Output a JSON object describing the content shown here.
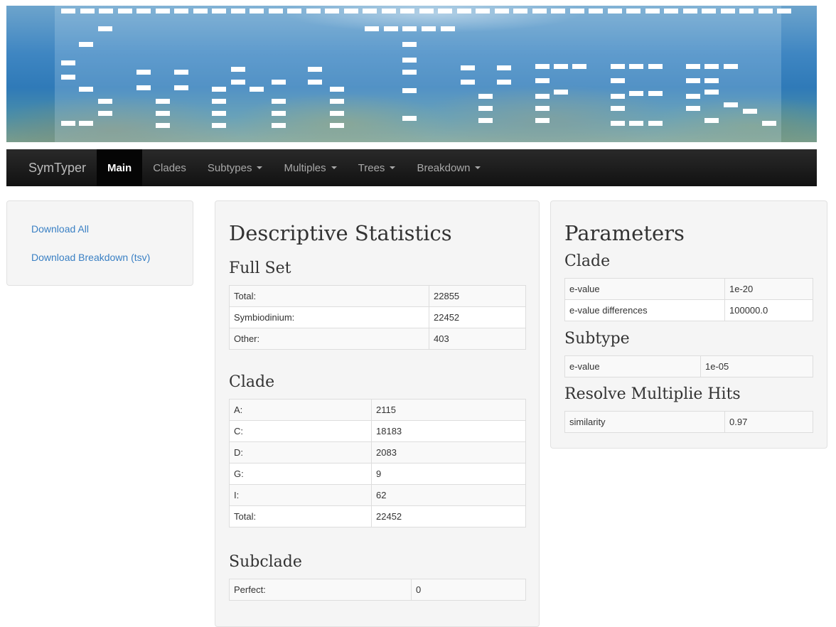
{
  "navbar": {
    "brand": "SymTyper",
    "items": [
      {
        "label": "Main"
      },
      {
        "label": "Clades"
      },
      {
        "label": "Subtypes"
      },
      {
        "label": "Multiples"
      },
      {
        "label": "Trees"
      },
      {
        "label": "Breakdown"
      }
    ]
  },
  "sidebar": {
    "links": [
      "Download All",
      "Download Breakdown (tsv)"
    ]
  },
  "descriptive": {
    "title": "Descriptive Statistics",
    "full_set": {
      "heading": "Full Set",
      "rows": [
        {
          "label": "Total:",
          "value": "22855"
        },
        {
          "label": "Symbiodinium:",
          "value": "22452"
        },
        {
          "label": "Other:",
          "value": "403"
        }
      ]
    },
    "clade": {
      "heading": "Clade",
      "rows": [
        {
          "label": "A:",
          "value": "2115"
        },
        {
          "label": "C:",
          "value": "18183"
        },
        {
          "label": "D:",
          "value": "2083"
        },
        {
          "label": "G:",
          "value": "9"
        },
        {
          "label": "I:",
          "value": "62"
        },
        {
          "label": "Total:",
          "value": "22452"
        }
      ]
    },
    "subclade": {
      "heading": "Subclade",
      "rows": [
        {
          "label": "Perfect:",
          "value": "0"
        }
      ]
    }
  },
  "parameters": {
    "title": "Parameters",
    "clade": {
      "heading": "Clade",
      "rows": [
        {
          "label": "e-value",
          "value": "1e-20"
        },
        {
          "label": "e-value differences",
          "value": "100000.0"
        }
      ]
    },
    "subtype": {
      "heading": "Subtype",
      "rows": [
        {
          "label": "e-value",
          "value": "1e-05"
        }
      ]
    },
    "resolve": {
      "heading": "Resolve Multiplie Hits",
      "rows": [
        {
          "label": "similarity",
          "value": "0.97"
        }
      ]
    }
  }
}
